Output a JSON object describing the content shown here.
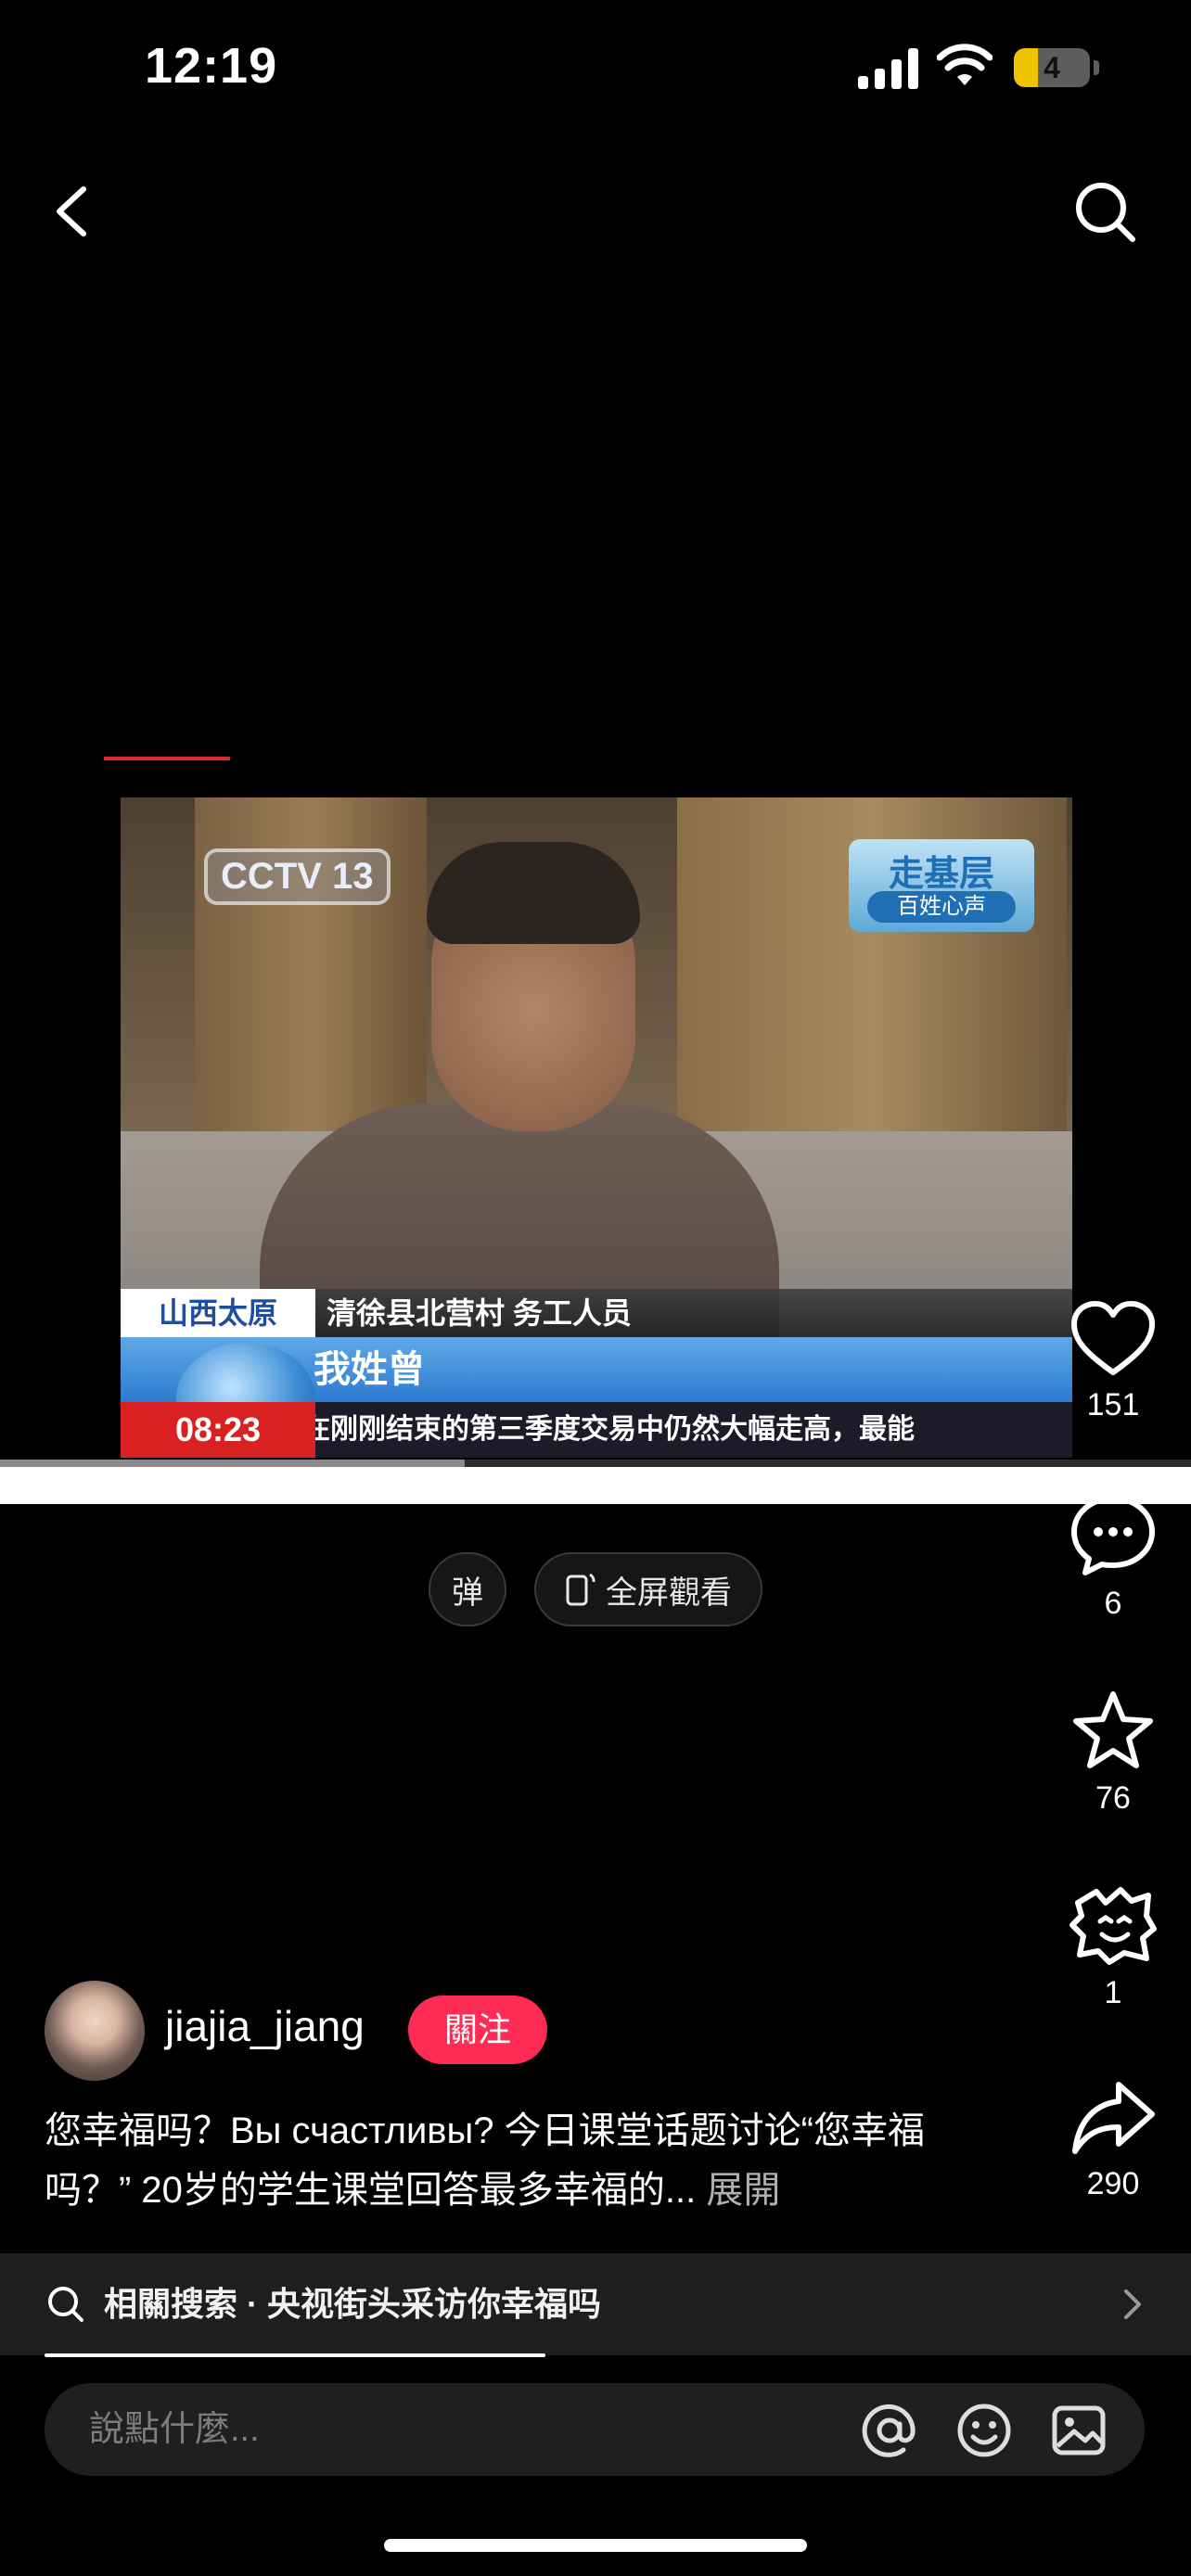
{
  "status_bar": {
    "time": "12:19",
    "battery_level": "4"
  },
  "video": {
    "channel_logo": "CCTV 13",
    "program_badge": [
      "走基层",
      "百姓心声"
    ],
    "location_tag": "山西太原",
    "speaker_role": "清徐县北营村 务工人员",
    "speaker_name": "我姓曾",
    "clock": "08:23",
    "ticker": "在刚刚结束的第三季度交易中仍然大幅走高，最能",
    "playback_progress": 0.39
  },
  "overlay_buttons": {
    "danmaku": "弹",
    "fullscreen": "全屏觀看"
  },
  "actions": {
    "like": "151",
    "comment": "6",
    "favorite": "76",
    "extension": "1",
    "share": "290"
  },
  "author": {
    "username": "jiajia_jiang",
    "follow_label": "關注"
  },
  "caption": {
    "text": "您幸福吗？Вы счастливы? 今日课堂话题讨论“您幸福吗？” 20岁的学生课堂回答最多幸福的...",
    "more": "展開"
  },
  "related_search": {
    "label": "相關搜索 · 央视街头采访你幸福吗"
  },
  "comment_input": {
    "placeholder": "說點什麼..."
  }
}
